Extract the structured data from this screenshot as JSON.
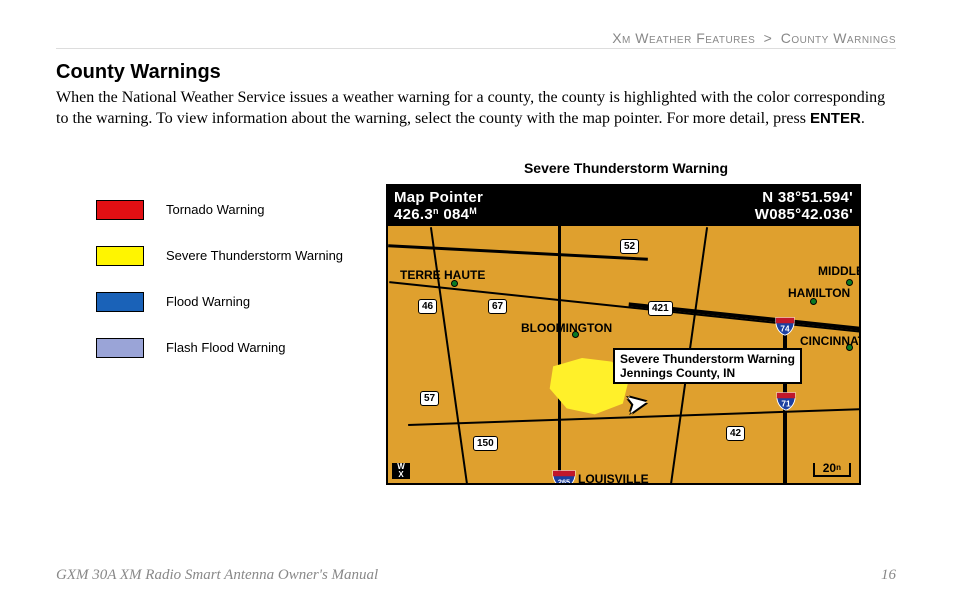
{
  "breadcrumb": {
    "section": "Xm Weather Features",
    "sep": ">",
    "page": "County Warnings"
  },
  "heading": "County Warnings",
  "body": {
    "p1a": "When the National Weather Service issues a weather warning for a county, the county is highlighted with the color corresponding to the warning. To view information about the warning, select the county with the map pointer. For more detail, press ",
    "enter": "ENTER",
    "p1b": "."
  },
  "legend": [
    {
      "color": "#e20f13",
      "label": "Tornado Warning"
    },
    {
      "color": "#fff500",
      "label": "Severe Thunderstorm Warning"
    },
    {
      "color": "#1a62b8",
      "label": "Flood Warning"
    },
    {
      "color": "#9aa4d7",
      "label": "Flash Flood Warning"
    }
  ],
  "map": {
    "caption": "Severe Thunderstorm Warning",
    "header": {
      "title": "Map Pointer",
      "dist": "426.3",
      "dist_unit": "n",
      "brg": "084",
      "brg_unit": "M",
      "lat": "N  38°51.594'",
      "lon": "W085°42.036'"
    },
    "tooltip": {
      "line1": "Severe Thunderstorm Warning",
      "line2": "Jennings County, IN"
    },
    "cities": {
      "terrehaute": "TERRE HAUTE",
      "bloomington": "BLOOMINGTON",
      "hamilton": "HAMILTON",
      "middle": "MIDDLE",
      "cincinnati": "CINCINNATI",
      "louisville": "LOUISVILLE"
    },
    "hwy": {
      "h52": "52",
      "h46": "46",
      "h67": "67",
      "h421": "421",
      "h57": "57",
      "h150": "150",
      "h42": "42"
    },
    "interstate": {
      "i74": "74",
      "i71": "71",
      "i265": "265"
    },
    "scale": {
      "value": "20",
      "unit": "n"
    },
    "wx": {
      "l1": "W",
      "l2": "X"
    }
  },
  "footer": {
    "title": "GXM 30A XM Radio Smart Antenna Owner's Manual",
    "page": "16"
  }
}
